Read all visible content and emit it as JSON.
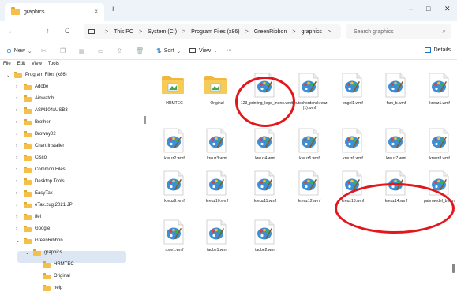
{
  "window": {
    "tab_title": "graphics",
    "tab_close": "×",
    "new_tab": "+",
    "minimize": "–",
    "maximize": "□",
    "close": "✕"
  },
  "nav": {
    "back": "←",
    "forward": "→",
    "up": "↑",
    "refresh": "C",
    "breadcrumb": [
      "This PC",
      "System (C:)",
      "Program Files (x86)",
      "GreenRibbon",
      "graphics"
    ],
    "separator": ">",
    "search_placeholder": "Search graphics"
  },
  "commands": {
    "new": "New",
    "sort": "Sort",
    "view": "View",
    "more": "···",
    "details": "Details"
  },
  "menu": [
    "File",
    "Edit",
    "View",
    "Tools"
  ],
  "tree": [
    {
      "label": "Program Files (x86)",
      "expanded": true,
      "level": 1
    },
    {
      "label": "Adobe",
      "level": 2
    },
    {
      "label": "Ainwatch",
      "level": 2
    },
    {
      "label": "ASM104xUSB3",
      "level": 2
    },
    {
      "label": "Brother",
      "level": 2
    },
    {
      "label": "Browny02",
      "level": 2
    },
    {
      "label": "Chart Installer",
      "level": 2
    },
    {
      "label": "Cisco",
      "level": 2
    },
    {
      "label": "Common Files",
      "level": 2
    },
    {
      "label": "Desktop Tools",
      "level": 2
    },
    {
      "label": "EasyTax",
      "level": 2
    },
    {
      "label": "eTax.zug.2021 JP",
      "level": 2
    },
    {
      "label": "ffel",
      "level": 2
    },
    {
      "label": "Google",
      "level": 2
    },
    {
      "label": "GreenRibbon",
      "expanded": true,
      "level": 2
    },
    {
      "label": "graphics",
      "expanded": true,
      "selected": true,
      "level": 3
    },
    {
      "label": "HRMTEC",
      "level": 4
    },
    {
      "label": "Original",
      "level": 4
    },
    {
      "label": "help",
      "level": 4
    }
  ],
  "files": [
    {
      "name": "HRMTEC",
      "type": "folder"
    },
    {
      "name": "Original",
      "type": "folder"
    },
    {
      "name": "123_printing_logo_mono.wmf",
      "type": "wmf"
    },
    {
      "name": "deutschordenskreuz (1).wmf",
      "type": "wmf"
    },
    {
      "name": "engel1.wmf",
      "type": "wmf"
    },
    {
      "name": "fam_b.wmf",
      "type": "wmf"
    },
    {
      "name": "kreuz1.wmf",
      "type": "wmf"
    },
    {
      "name": "kreuz2.wmf",
      "type": "wmf"
    },
    {
      "name": "kreuz3.wmf",
      "type": "wmf"
    },
    {
      "name": "kreuz4.wmf",
      "type": "wmf"
    },
    {
      "name": "kreuz5.wmf",
      "type": "wmf"
    },
    {
      "name": "kreuz6.wmf",
      "type": "wmf"
    },
    {
      "name": "kreuz7.wmf",
      "type": "wmf"
    },
    {
      "name": "kreuz8.wmf",
      "type": "wmf"
    },
    {
      "name": "kreuz9.wmf",
      "type": "wmf"
    },
    {
      "name": "kreuz10.wmf",
      "type": "wmf"
    },
    {
      "name": "kreuz11.wmf",
      "type": "wmf"
    },
    {
      "name": "kreuz12.wmf",
      "type": "wmf"
    },
    {
      "name": "kreuz13.wmf",
      "type": "wmf"
    },
    {
      "name": "kreuz14.wmf",
      "type": "wmf"
    },
    {
      "name": "palmwedel_b.wmf",
      "type": "wmf"
    },
    {
      "name": "rose1.wmf",
      "type": "wmf"
    },
    {
      "name": "taube1.wmf",
      "type": "wmf"
    },
    {
      "name": "taube2.wmf",
      "type": "wmf"
    }
  ],
  "colors": {
    "accent": "#1a73c8",
    "folder": "#f4c04a",
    "annotation": "#e3171b",
    "selection": "#dde7f3"
  }
}
